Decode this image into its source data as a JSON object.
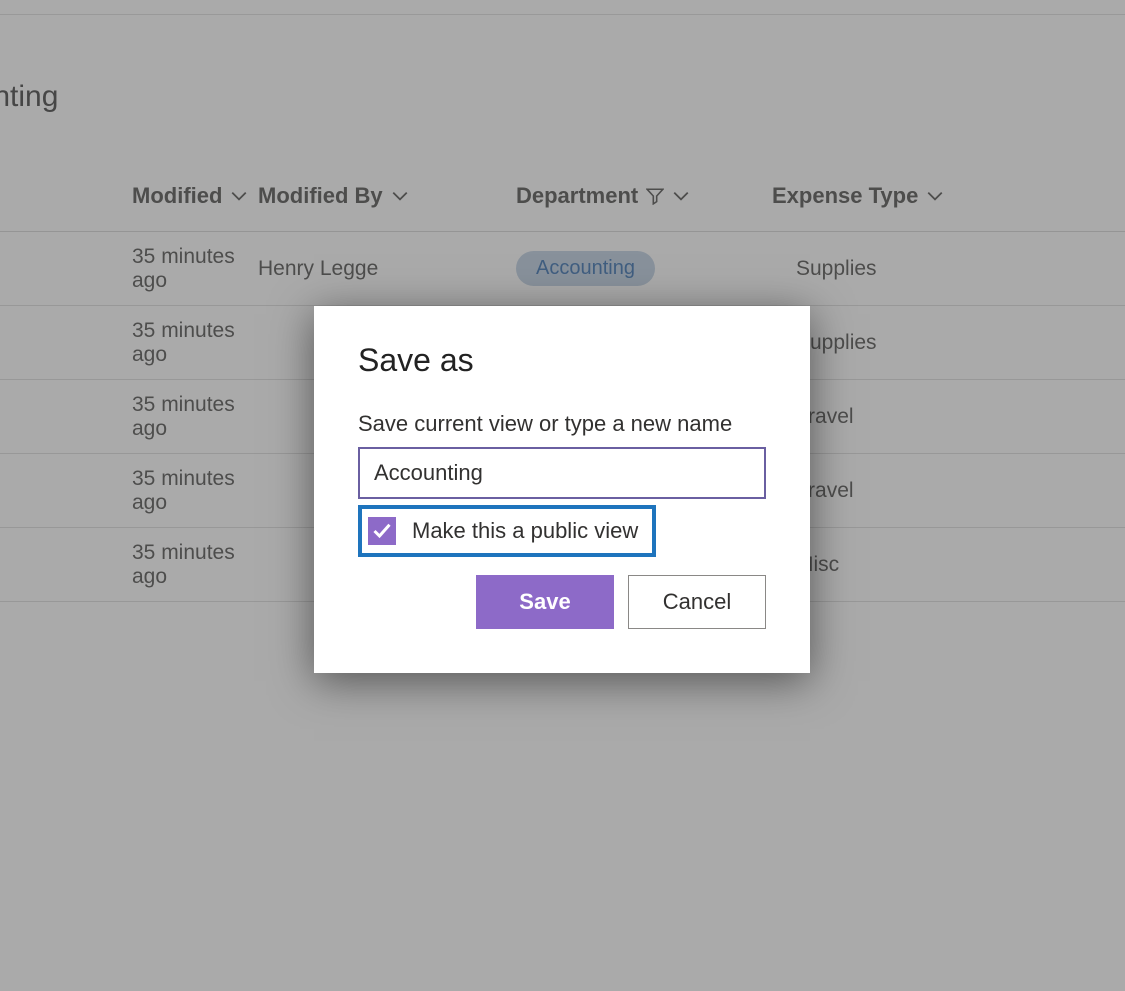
{
  "page": {
    "title_fragment": "ounting"
  },
  "table": {
    "headers": {
      "modified": "Modified",
      "modifiedBy": "Modified By",
      "department": "Department",
      "expenseType": "Expense Type"
    },
    "rows": [
      {
        "modified": "35 minutes ago",
        "modifiedBy": "Henry Legge",
        "department": "Accounting",
        "expenseType": "Supplies"
      },
      {
        "modified": "35 minutes ago",
        "modifiedBy": "",
        "department": "",
        "expenseType": "Supplies"
      },
      {
        "modified": "35 minutes ago",
        "modifiedBy": "",
        "department": "",
        "expenseType": "Travel"
      },
      {
        "modified": "35 minutes ago",
        "modifiedBy": "",
        "department": "",
        "expenseType": "Travel"
      },
      {
        "modified": "35 minutes ago",
        "modifiedBy": "",
        "department": "",
        "expenseType": "Misc"
      }
    ]
  },
  "dialog": {
    "title": "Save as",
    "label": "Save current view or type a new name",
    "input_value": "Accounting",
    "checkbox_label": "Make this a public view",
    "checkbox_checked": true,
    "save": "Save",
    "cancel": "Cancel"
  },
  "colors": {
    "accent": "#8d6ac8",
    "highlight_border": "#1e74bd",
    "pill_bg": "#b3c8de",
    "pill_fg": "#1658a3"
  }
}
